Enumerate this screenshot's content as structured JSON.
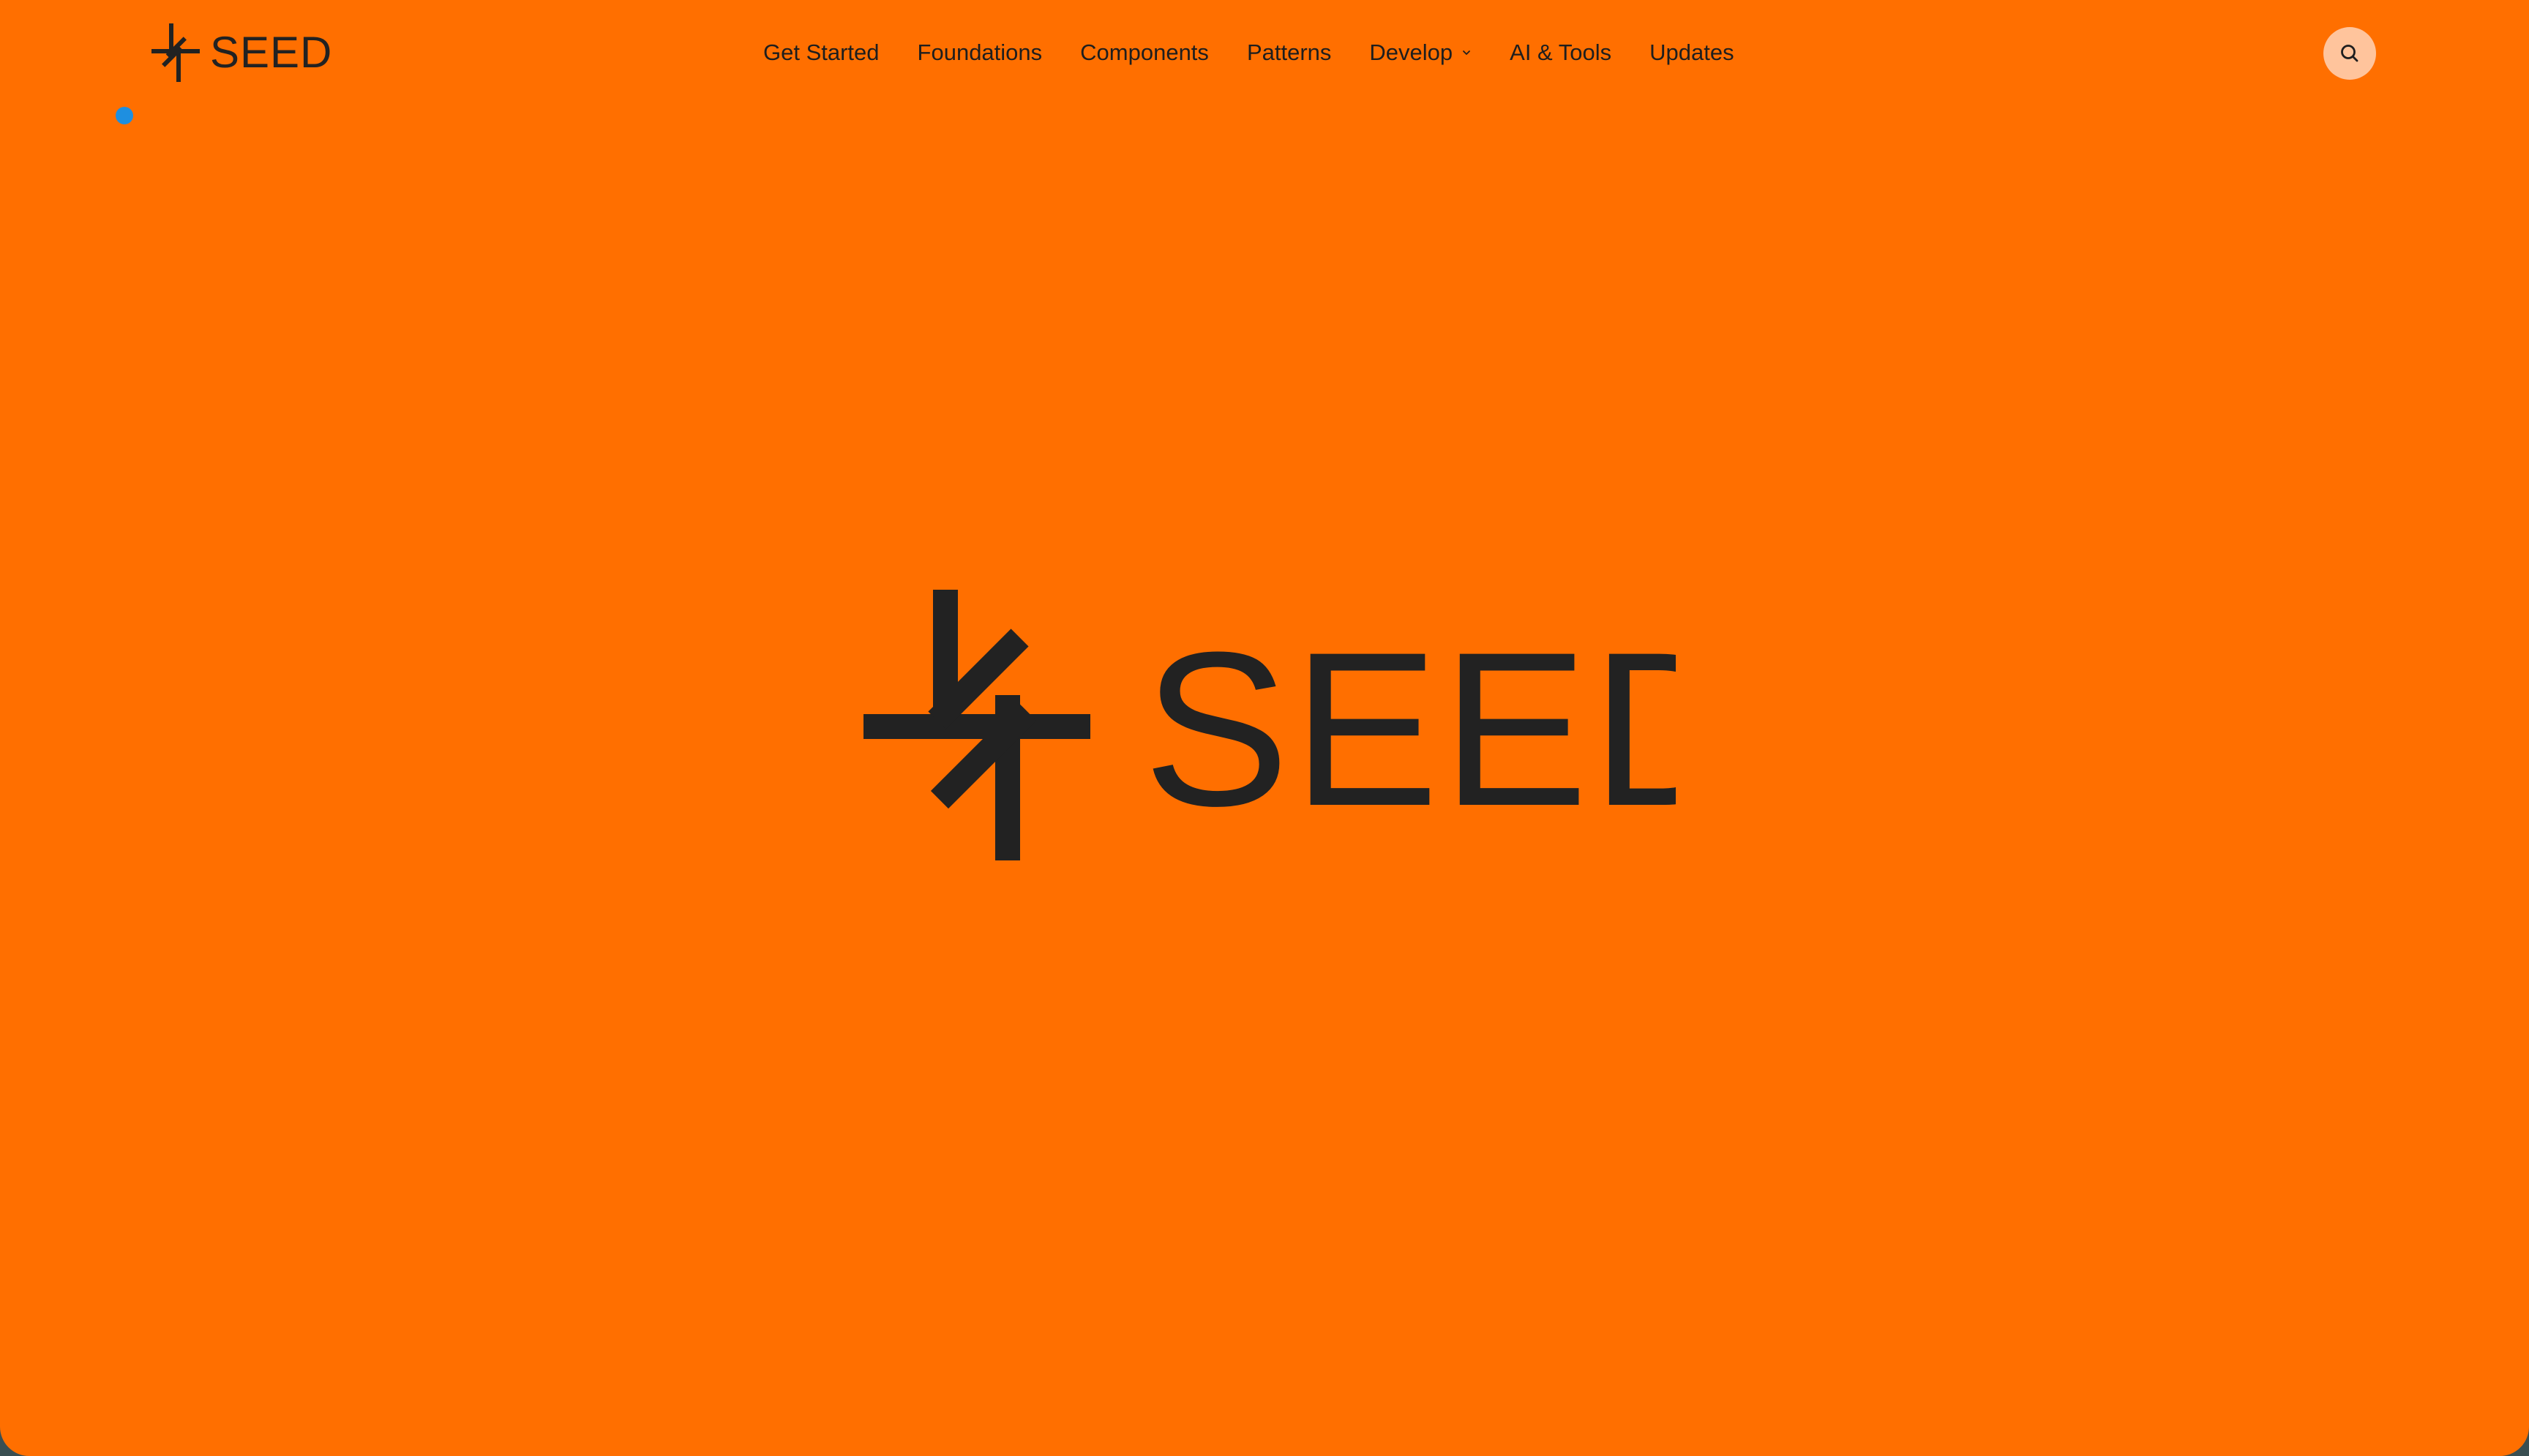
{
  "brand": {
    "logo_text": "SEED",
    "logo_icon": "seed-spark-icon"
  },
  "nav": {
    "items": [
      {
        "label": "Get Started"
      },
      {
        "label": "Foundations"
      },
      {
        "label": "Components"
      },
      {
        "label": "Patterns"
      },
      {
        "label": "Develop",
        "has_dropdown": true,
        "dropdown_icon": "chevron-down-icon"
      },
      {
        "label": "AI & Tools"
      },
      {
        "label": "Updates"
      }
    ]
  },
  "search": {
    "icon": "search-icon"
  },
  "hero": {
    "logo_text": "SEED",
    "logo_icon": "seed-spark-icon"
  },
  "colors": {
    "background": "#ff6f00",
    "text": "#222222",
    "search_button_bg": "#ffc49c",
    "indicator_dot": "#1e8fe0"
  }
}
